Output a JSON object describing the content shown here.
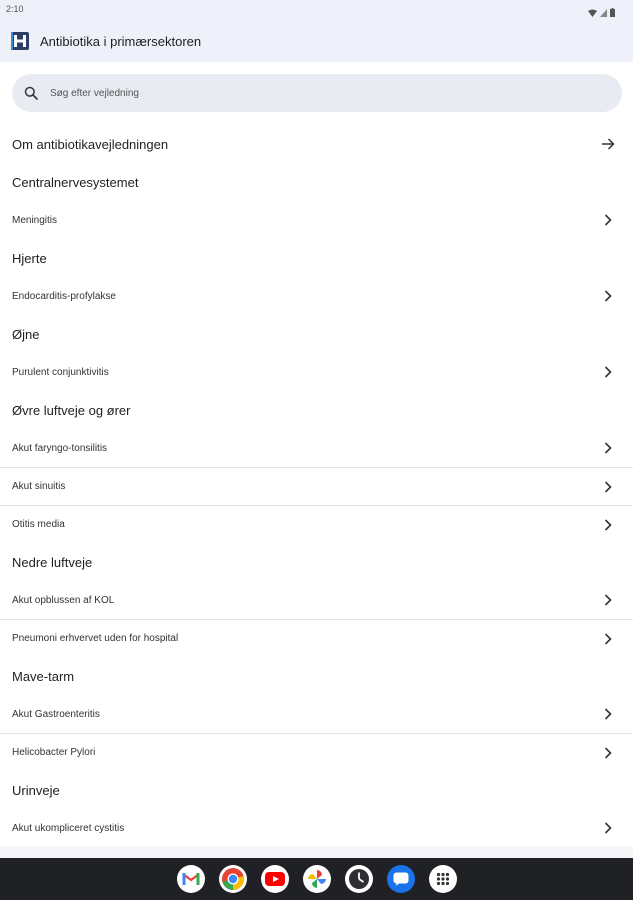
{
  "status_bar": {
    "time": "2:10"
  },
  "app_bar": {
    "title": "Antibiotika i primærsektoren"
  },
  "search": {
    "placeholder": "Søg efter vejledning"
  },
  "rows": [
    {
      "type": "nav",
      "label": "Om antibiotikavejledningen"
    },
    {
      "type": "heading",
      "label": "Centralnervesystemet"
    },
    {
      "type": "item",
      "label": "Meningitis"
    },
    {
      "type": "heading",
      "label": "Hjerte"
    },
    {
      "type": "item",
      "label": "Endocarditis-profylakse"
    },
    {
      "type": "heading",
      "label": "Øjne"
    },
    {
      "type": "item",
      "label": "Purulent conjunktivitis"
    },
    {
      "type": "heading",
      "label": "Øvre luftveje og ører"
    },
    {
      "type": "item",
      "label": "Akut faryngo-tonsilitis"
    },
    {
      "type": "item",
      "label": "Akut sinuitis"
    },
    {
      "type": "item",
      "label": "Otitis media"
    },
    {
      "type": "heading",
      "label": "Nedre luftveje"
    },
    {
      "type": "item",
      "label": "Akut opblussen af KOL"
    },
    {
      "type": "item",
      "label": "Pneumoni erhvervet uden for hospital"
    },
    {
      "type": "heading",
      "label": "Mave-tarm"
    },
    {
      "type": "item",
      "label": "Akut Gastroenteritis"
    },
    {
      "type": "item",
      "label": "Helicobacter Pylori"
    },
    {
      "type": "heading",
      "label": "Urinveje"
    },
    {
      "type": "item",
      "label": "Akut ukompliceret cystitis"
    }
  ],
  "dock": [
    {
      "icon": "gmail-icon",
      "color": "#ffffff"
    },
    {
      "icon": "chrome-icon",
      "color": "#ffffff"
    },
    {
      "icon": "youtube-icon",
      "color": "#ffffff"
    },
    {
      "icon": "photos-icon",
      "color": "#ffffff"
    },
    {
      "icon": "clock-icon",
      "color": "#ffffff"
    },
    {
      "icon": "messages-icon",
      "color": "#1a73e8"
    },
    {
      "icon": "app-drawer-icon",
      "color": "#ffffff"
    }
  ]
}
